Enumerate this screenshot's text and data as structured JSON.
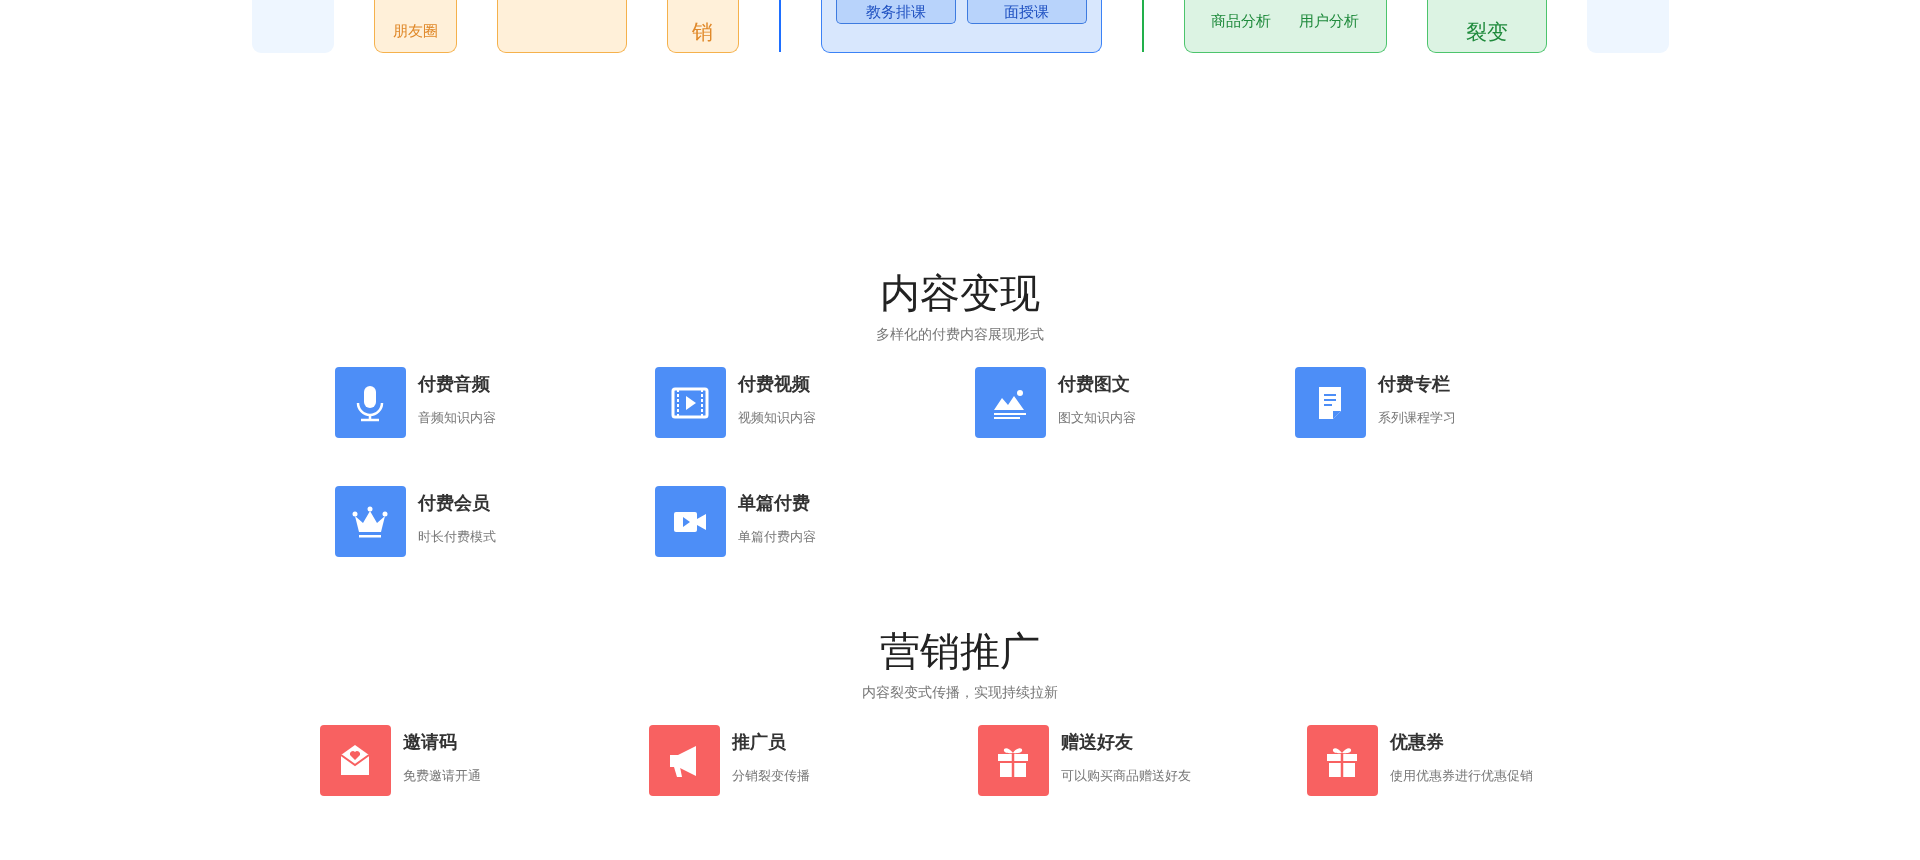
{
  "top_strip": [
    {
      "kind": "pale"
    },
    {
      "kind": "orange",
      "label": "朋友圈"
    },
    {
      "kind": "orange-wide"
    },
    {
      "kind": "orange-big",
      "label": "销"
    },
    {
      "kind": "divider",
      "color": "#1e6fff"
    },
    {
      "kind": "blue",
      "buttons": [
        "教务排课",
        "面授课"
      ]
    },
    {
      "kind": "divider",
      "color": "#22b04b"
    },
    {
      "kind": "green",
      "labels": [
        "商品分析",
        "用户分析"
      ]
    },
    {
      "kind": "green-big",
      "label": "裂变"
    },
    {
      "kind": "pale"
    }
  ],
  "sections": [
    {
      "title": "内容变现",
      "subtitle": "多样化的付费内容展现形式",
      "kind": "blue",
      "items": [
        {
          "title": "付费音频",
          "desc": "音频知识内容"
        },
        {
          "title": "付费视频",
          "desc": "视频知识内容"
        },
        {
          "title": "付费图文",
          "desc": "图文知识内容"
        },
        {
          "title": "付费专栏",
          "desc": "系列课程学习"
        },
        {
          "title": "付费会员",
          "desc": "时长付费模式"
        },
        {
          "title": "单篇付费",
          "desc": "单篇付费内容"
        }
      ]
    },
    {
      "title": "营销推广",
      "subtitle": "内容裂变式传播，实现持续拉新",
      "kind": "red",
      "items": [
        {
          "title": "邀请码",
          "desc": "免费邀请开通"
        },
        {
          "title": "推广员",
          "desc": "分销裂变传播"
        },
        {
          "title": "赠送好友",
          "desc": "可以购买商品赠送好友"
        },
        {
          "title": "优惠券",
          "desc": "使用优惠券进行优惠促销"
        }
      ]
    }
  ]
}
